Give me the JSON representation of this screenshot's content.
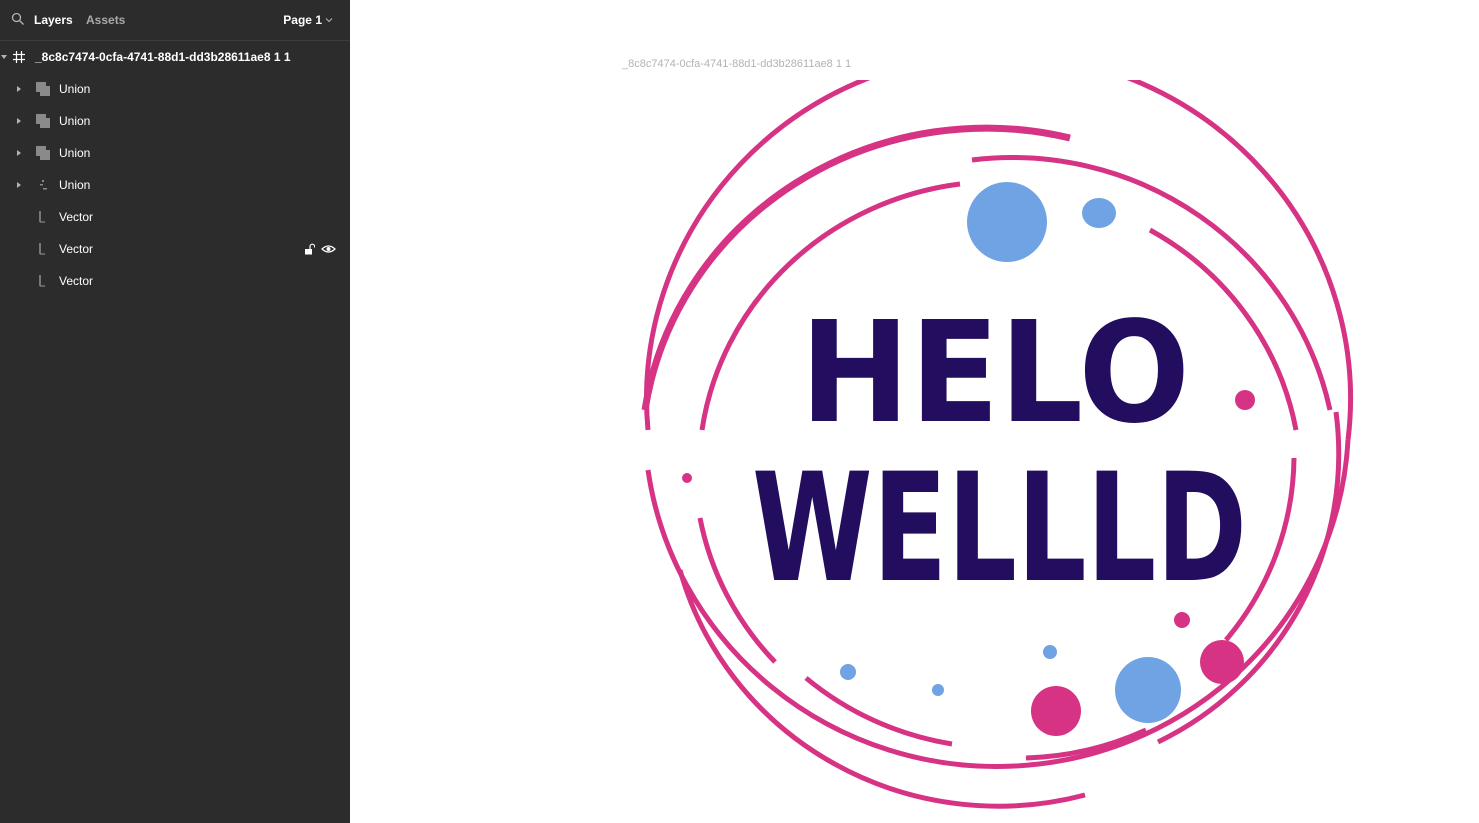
{
  "panel": {
    "tabs": [
      {
        "label": "Layers",
        "active": true
      },
      {
        "label": "Assets",
        "active": false
      }
    ],
    "page_label": "Page 1"
  },
  "layers": {
    "frame": {
      "name": "_8c8c7474-0cfa-4741-88d1-dd3b28611ae8 1 1",
      "icon": "frame-icon"
    },
    "children": [
      {
        "name": "Union",
        "icon": "union-icon"
      },
      {
        "name": "Union",
        "icon": "union-icon"
      },
      {
        "name": "Union",
        "icon": "union-icon"
      },
      {
        "name": "Union",
        "icon": "union-icon"
      },
      {
        "name": "Vector",
        "icon": "vector-icon"
      },
      {
        "name": "Vector",
        "icon": "vector-icon",
        "hovered": true
      },
      {
        "name": "Vector",
        "icon": "vector-icon"
      }
    ]
  },
  "canvas": {
    "frame_label": "_8c8c7474-0cfa-4741-88d1-dd3b28611ae8 1 1",
    "artwork": {
      "line1": "HELO",
      "line2": "WELLLD",
      "colors": {
        "ring": "#d63384",
        "text_dark": "#230d5e",
        "text_teal": "#2e7aa3",
        "dot_blue": "#6fa3e3",
        "dot_pink": "#d63384"
      }
    }
  }
}
